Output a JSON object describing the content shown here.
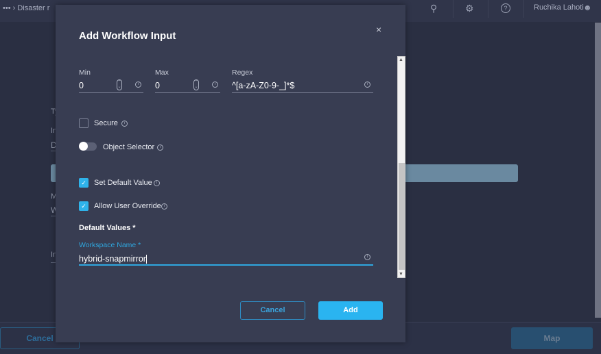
{
  "topbar": {
    "breadcrumb": "••• ›  Disaster r",
    "user": "Ruchika Lahoti",
    "icons": [
      "search-icon",
      "gear-icon",
      "help-icon",
      "user-icon"
    ]
  },
  "background": {
    "labels": [
      "Ty",
      "In",
      "D",
      "M",
      "W",
      "In"
    ],
    "cancel_label": "Cancel",
    "map_label": "Map"
  },
  "modal": {
    "title": "Add Workflow Input",
    "close_glyph": "×",
    "min": {
      "label": "Min",
      "value": "0"
    },
    "max": {
      "label": "Max",
      "value": "0"
    },
    "regex": {
      "label": "Regex",
      "value": "^[a-zA-Z0-9-_]*$"
    },
    "secure": {
      "label": "Secure",
      "checked": false
    },
    "object_selector": {
      "label": "Object Selector",
      "on": false
    },
    "set_default": {
      "label": "Set Default Value",
      "checked": true
    },
    "allow_override": {
      "label": "Allow User Override",
      "checked": true
    },
    "default_values_label": "Default Values *",
    "workspace": {
      "label": "Workspace Name *",
      "value": "hybrid-snapmirror"
    },
    "cancel_label": "Cancel",
    "add_label": "Add"
  },
  "colors": {
    "accent": "#2ab4f0",
    "modal_bg": "#383d52",
    "page_bg": "#2a2f42"
  }
}
